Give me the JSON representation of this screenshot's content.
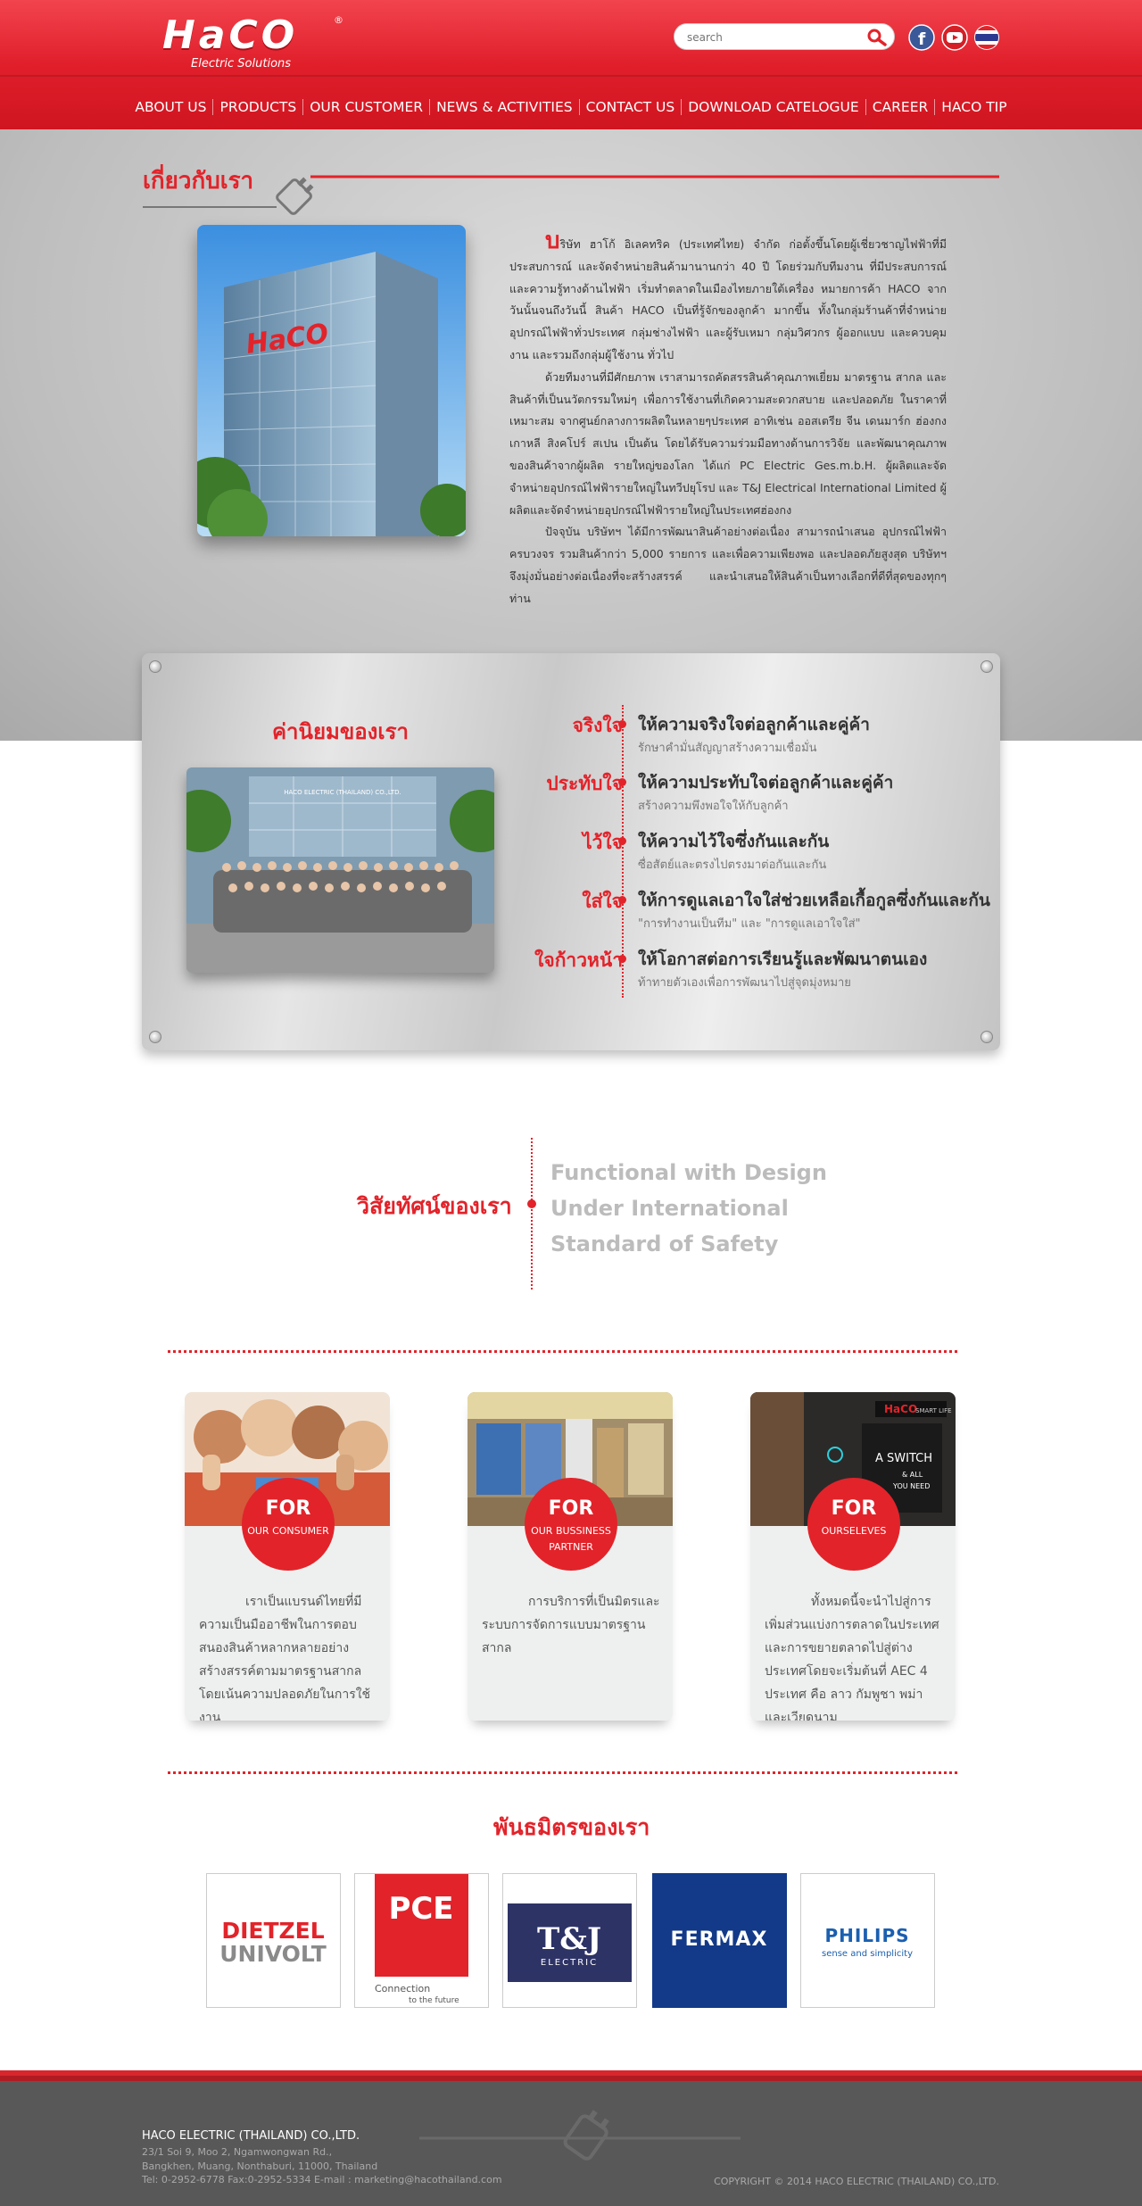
{
  "header": {
    "logo_word": "HaCO",
    "logo_reg": "®",
    "logo_sub": "Electric Solutions",
    "search_placeholder": "search"
  },
  "nav": [
    "ABOUT US",
    "PRODUCTS",
    "OUR CUSTOMER",
    "NEWS & ACTIVITIES",
    "CONTACT US",
    "DOWNLOAD CATELOGUE",
    "CAREER",
    "HACO TIP"
  ],
  "about": {
    "title": "เกี่ยวกับเรา",
    "drop_cap": "บ",
    "p1": "ริษัท ฮาโก้ อิเลคทริค (ประเทศไทย) จำกัด ก่อตั้งขึ้นโดยผู้เชี่ยวชาญไฟฟ้าที่มีประสบการณ์ และจัดจำหน่ายสินค้ามานานกว่า 40 ปี โดยร่วมกับทีมงาน ที่มีประสบการณ์และความรู้ทางด้านไฟฟ้า เริ่มทำตลาดในเมืองไทยภายใต้เครื่อง หมายการค้า HACO จากวันนั้นจนถึงวันนี้ สินค้า HACO เป็นที่รู้จักของลูกค้า มากขึ้น ทั้งในกลุ่มร้านค้าที่จำหน่ายอุปกรณ์ไฟฟ้าทั่วประเทศ กลุ่มช่างไฟฟ้า และผู้รับเหมา กลุ่มวิศวกร ผู้ออกแบบ และควบคุมงาน และรวมถึงกลุ่มผู้ใช้งาน ทั่วไป",
    "p2": "ด้วยทีมงานที่มีศักยภาพ เราสามารถคัดสรรสินค้าคุณภาพเยี่ยม มาตรฐาน สากล และสินค้าที่เป็นนวัตกรรมใหม่ๆ เพื่อการใช้งานที่เกิดความสะดวกสบาย และปลอดภัย ในราคาที่เหมาะสม จากศูนย์กลางการผลิตในหลายๆประเทศ อาทิเช่น ออสเตรีย จีน เดนมาร์ก ฮ่องกง เกาหลี สิงคโปร์ สเปน เป็นต้น โดยได้รับความร่วมมือทางด้านการวิจัย และพัฒนาคุณภาพของสินค้าจากผู้ผลิต รายใหญ่ของโลก ได้แก่ PC Electric Ges.m.b.H. ผู้ผลิตและจัดจำหน่ายอุปกรณ์ไฟฟ้ารายใหญ่ในทวีปยุโรป และ T&J Electrical International Limited ผู้ผลิตและจัดจำหน่ายอุปกรณ์ไฟฟ้ารายใหญ่ในประเทศฮ่องกง",
    "p3": "ปัจจุบัน บริษัทฯ ได้มีการพัฒนาสินค้าอย่างต่อเนื่อง สามารถนำเสนอ อุปกรณ์ไฟฟ้าครบวงจร รวมสินค้ากว่า 5,000 รายการ และเพื่อความเพียงพอ และปลอดภัยสูงสุด บริษัทฯ จึงมุ่งมั่นอย่างต่อเนื่องที่จะสร้างสรรค์ และนำเสนอให้สินค้าเป็นทางเลือกที่ดีที่สุดของทุกๆ ท่าน",
    "building_sign": "HaCO"
  },
  "values": {
    "title": "ค่านิยมของเรา",
    "banner": "HACO ELECTRIC (THAILAND) CO.,LTD.",
    "items": [
      {
        "label": "จริงใจ",
        "head": "ให้ความจริงใจต่อลูกค้าและคู่ค้า",
        "sub": "รักษาคำมั่นสัญญาสร้างความเชื่อมั่น"
      },
      {
        "label": "ประทับใจ",
        "head": "ให้ความประทับใจต่อลูกค้าและคู่ค้า",
        "sub": "สร้างความพึงพอใจให้กับลูกค้า"
      },
      {
        "label": "ไว้ใจ",
        "head": "ให้ความไว้ใจซึ่งกันและกัน",
        "sub": "ซื่อสัตย์และตรงไปตรงมาต่อกันและกัน"
      },
      {
        "label": "ใส่ใจ",
        "head": "ให้การดูแลเอาใจใส่ช่วยเหลือเกื้อกูลซึ่งกันและกัน",
        "sub": "\"การทำงานเป็นทีม\" และ \"การดูแลเอาใจใส่\""
      },
      {
        "label": "ใจก้าวหน้า",
        "head": "ให้โอกาสต่อการเรียนรู้และพัฒนาตนเอง",
        "sub": "ท้าทายตัวเองเพื่อการพัฒนาไปสู่จุดมุ่งหมาย"
      }
    ]
  },
  "vision": {
    "title": "วิสัยทัศน์ของเรา",
    "lines": [
      "Functional with Design",
      "Under International",
      "Standard of Safety"
    ]
  },
  "cards": [
    {
      "for": "FOR",
      "who": "OUR CONSUMER",
      "text": "เราเป็นแบรนด์ไทยที่มีความเป็นมืออาชีพในการตอบสนองสินค้าหลากหลายอย่างสร้างสรรค์ตามมาตรฐานสากล โดยเน้นความปลอดภัยในการใช้งาน"
    },
    {
      "for": "FOR",
      "who": "OUR BUSSINESS PARTNER",
      "text": "การบริการที่เป็นมิตรและระบบการจัดการแบบมาตรฐานสากล"
    },
    {
      "for": "FOR",
      "who": "OURSELEVES",
      "text": "ทั้งหมดนี้จะนำไปสู่การเพิ่มส่วนแบ่งการตลาดในประเทศและการขยายตลาดไปสู่ต่างประเทศโดยจะเริ่มต้นที่ AEC 4 ประเทศ คือ ลาว กัมพูชา พม่า และเวียดนาม"
    }
  ],
  "card3_screen": {
    "brand": "HaCO",
    "brand_sub": "SMART LIFE",
    "line1": "A SWITCH",
    "line2": "& ALL",
    "line3": "YOU NEED"
  },
  "partners": {
    "title": "พันธมิตรของเรา",
    "logos": [
      {
        "name": "DIETZEL UNIVOLT",
        "l1": "DIETZEL",
        "l2": "UNIVOLT"
      },
      {
        "name": "PCE",
        "l1": "PCE",
        "l2": "Connection",
        "l3": "to the future"
      },
      {
        "name": "T&J ELECTRIC",
        "l1": "T&J",
        "l2": "ELECTRIC"
      },
      {
        "name": "FERMAX",
        "l1": "FERMAX"
      },
      {
        "name": "PHILIPS",
        "l1": "PHILIPS",
        "l2": "sense and simplicity"
      }
    ]
  },
  "footer": {
    "company": "HACO ELECTRIC (THAILAND) CO.,LTD.",
    "addr1": "23/1 Soi 9, Moo 2, Ngamwongwan Rd.,",
    "addr2": "Bangkhen, Muang, Nonthaburi, 11000, Thailand",
    "contact": "Tel: 0-2952-6778 Fax:0-2952-5334 E-mail : marketing@hacothailand.com",
    "copyright": "COPYRIGHT © 2014 HACO ELECTRIC (THAILAND) CO.,LTD."
  },
  "colors": {
    "brand_red": "#e2232a",
    "footer_grey": "#585858",
    "panel_grey": "#d6d6d6"
  }
}
